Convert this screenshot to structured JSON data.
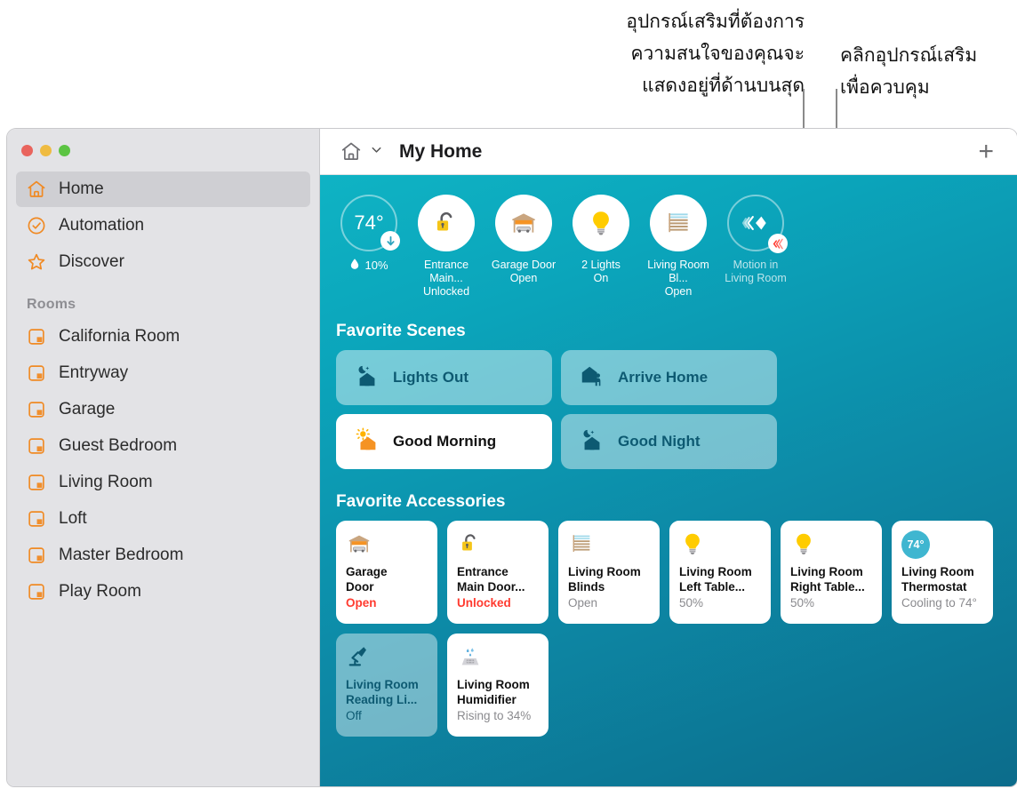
{
  "callouts": {
    "left": "อุปกรณ์เสริมที่ต้องการ\nความสนใจของคุณจะ\nแสดงอยู่ที่ด้านบนสุด",
    "right": "คลิกอุปกรณ์เสริม\nเพื่อควบคุม"
  },
  "window": {
    "titlebar": {
      "home_icon": "home-icon",
      "chevron": "⌄",
      "title": "My Home",
      "add_label": "+"
    }
  },
  "sidebar": {
    "nav": [
      {
        "label": "Home",
        "icon": "home-icon",
        "selected": true
      },
      {
        "label": "Automation",
        "icon": "clock-check-icon",
        "selected": false
      },
      {
        "label": "Discover",
        "icon": "star-icon",
        "selected": false
      }
    ],
    "rooms_header": "Rooms",
    "rooms": [
      {
        "label": "California Room",
        "icon": "room-icon"
      },
      {
        "label": "Entryway",
        "icon": "room-icon"
      },
      {
        "label": "Garage",
        "icon": "room-icon"
      },
      {
        "label": "Guest Bedroom",
        "icon": "room-icon"
      },
      {
        "label": "Living Room",
        "icon": "room-icon"
      },
      {
        "label": "Loft",
        "icon": "room-icon"
      },
      {
        "label": "Master Bedroom",
        "icon": "room-icon"
      },
      {
        "label": "Play Room",
        "icon": "room-icon"
      }
    ]
  },
  "status_strip": [
    {
      "kind": "climate",
      "temperature": "74°",
      "humidity": "10%",
      "icon": "thermostat-dial",
      "badge": "arrow-down-icon"
    },
    {
      "kind": "accessory",
      "icon": "unlocked-padlock-icon",
      "caption": "Entrance Main...\nUnlocked"
    },
    {
      "kind": "accessory",
      "icon": "garage-door-icon",
      "caption": "Garage Door\nOpen"
    },
    {
      "kind": "accessory",
      "icon": "lightbulb-icon",
      "caption": "2 Lights\nOn"
    },
    {
      "kind": "accessory",
      "icon": "blinds-icon",
      "caption": "Living Room Bl...\nOpen"
    },
    {
      "kind": "sensor",
      "icon": "motion-sensor-icon",
      "caption": "Motion in\nLiving Room",
      "badge": "motion-wave-icon"
    }
  ],
  "scenes": {
    "title": "Favorite Scenes",
    "items": [
      {
        "label": "Lights Out",
        "icon": "moon-house-icon",
        "active": false
      },
      {
        "label": "Arrive Home",
        "icon": "house-person-icon",
        "active": false
      },
      {
        "label": "Good Morning",
        "icon": "sun-house-icon",
        "active": true
      },
      {
        "label": "Good Night",
        "icon": "moon-house-icon",
        "active": false
      }
    ]
  },
  "accessories": {
    "title": "Favorite Accessories",
    "items": [
      {
        "name": "Garage\nDoor",
        "state": "Open",
        "alert": true,
        "off": false,
        "icon": "garage-door-icon"
      },
      {
        "name": "Entrance\nMain Door...",
        "state": "Unlocked",
        "alert": true,
        "off": false,
        "icon": "unlocked-padlock-icon"
      },
      {
        "name": "Living Room\nBlinds",
        "state": "Open",
        "alert": false,
        "off": false,
        "icon": "blinds-icon"
      },
      {
        "name": "Living Room\nLeft Table...",
        "state": "50%",
        "alert": false,
        "off": false,
        "icon": "lightbulb-icon"
      },
      {
        "name": "Living Room\nRight Table...",
        "state": "50%",
        "alert": false,
        "off": false,
        "icon": "lightbulb-icon"
      },
      {
        "name": "Living Room\nThermostat",
        "state": "Cooling to 74°",
        "alert": false,
        "off": false,
        "icon": "thermostat-bubble-icon",
        "bubble": "74°"
      },
      {
        "name": "Living Room\nReading Li...",
        "state": "Off",
        "alert": false,
        "off": true,
        "icon": "desk-lamp-icon"
      },
      {
        "name": "Living Room\nHumidifier",
        "state": "Rising to 34%",
        "alert": false,
        "off": false,
        "icon": "humidifier-icon"
      }
    ]
  }
}
